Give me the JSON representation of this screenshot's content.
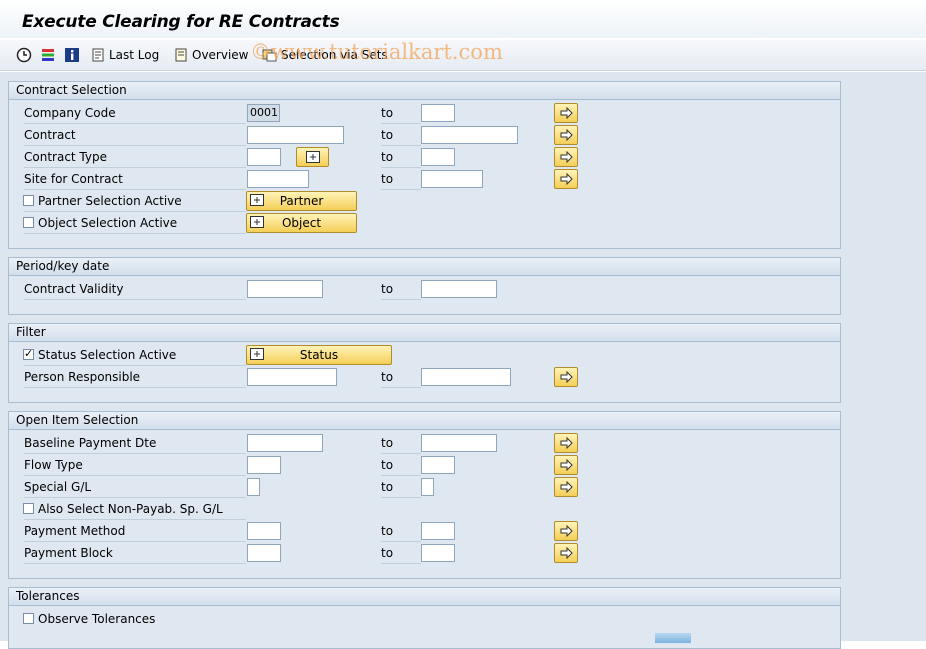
{
  "window": {
    "title": "Execute Clearing for RE Contracts"
  },
  "toolbar": {
    "execute_icon": "execute-clock-icon",
    "variant_icon": "get-variant-icon",
    "info_icon": "info-icon",
    "last_log": "Last Log",
    "overview": "Overview",
    "selection_via_sets": "Selection via Sets"
  },
  "watermark": "©www.tutorialkart.com",
  "contract_selection": {
    "header": "Contract Selection",
    "company_code": {
      "label": "Company Code",
      "from": "0001",
      "to_label": "to",
      "to": ""
    },
    "contract": {
      "label": "Contract",
      "from": "",
      "to_label": "to",
      "to": ""
    },
    "contract_type": {
      "label": "Contract Type",
      "from": "",
      "to_label": "to",
      "to": ""
    },
    "site_for_contract": {
      "label": "Site for Contract",
      "from": "",
      "to_label": "to",
      "to": ""
    },
    "partner_selection": {
      "label": "Partner Selection Active",
      "checked": false,
      "button": "Partner"
    },
    "object_selection": {
      "label": "Object Selection Active",
      "checked": false,
      "button": "Object"
    }
  },
  "period": {
    "header": "Period/key date",
    "contract_validity": {
      "label": "Contract Validity",
      "from": "",
      "to_label": "to",
      "to": ""
    }
  },
  "filter": {
    "header": "Filter",
    "status_selection": {
      "label": "Status Selection Active",
      "checked": true,
      "button": "Status"
    },
    "person_responsible": {
      "label": "Person Responsible",
      "from": "",
      "to_label": "to",
      "to": ""
    }
  },
  "open_item_selection": {
    "header": "Open Item Selection",
    "baseline_payment_date": {
      "label": "Baseline Payment Dte",
      "from": "",
      "to_label": "to",
      "to": ""
    },
    "flow_type": {
      "label": "Flow Type",
      "from": "",
      "to_label": "to",
      "to": ""
    },
    "special_gl": {
      "label": "Special G/L",
      "from": "",
      "to_label": "to",
      "to": ""
    },
    "non_payab": {
      "label": "Also Select Non-Payab. Sp. G/L",
      "checked": false
    },
    "payment_method": {
      "label": "Payment Method",
      "from": "",
      "to_label": "to",
      "to": ""
    },
    "payment_block": {
      "label": "Payment Block",
      "from": "",
      "to_label": "to",
      "to": ""
    }
  },
  "tolerances": {
    "header": "Tolerances",
    "observe_tolerances": {
      "label": "Observe Tolerances",
      "checked": false
    }
  },
  "colors": {
    "accent_button": "#f4cf58",
    "group_border": "#a9bdd2",
    "background": "#dde6ef"
  }
}
